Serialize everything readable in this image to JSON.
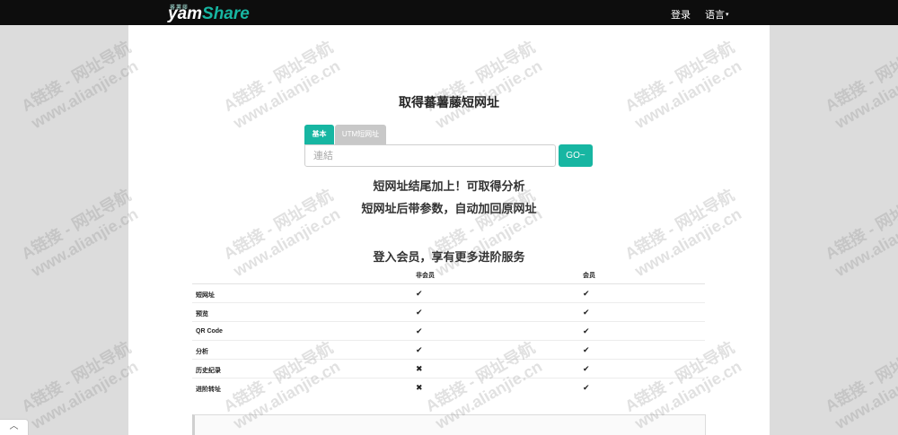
{
  "navbar": {
    "logo_small": "蕃薯藤",
    "logo_yam": "yam",
    "logo_share": "Share",
    "login_label": "登录",
    "language_label": "语言"
  },
  "main": {
    "title": "取得蕃薯藤短网址",
    "tabs": [
      {
        "label": "基本",
        "active": true
      },
      {
        "label": "UTM短网址",
        "active": false
      }
    ],
    "url_placeholder": "連結",
    "go_label": "GO~",
    "tip_1": "短网址结尾加上！可取得分析",
    "tip_2": "短网址后带参数，自动加回原网址",
    "members_title": "登入会员，享有更多进阶服务"
  },
  "comparison": {
    "headers": [
      "",
      "非会员",
      "会员"
    ],
    "rows": [
      {
        "feature": "短网址",
        "non_member": "✔",
        "member": "✔"
      },
      {
        "feature": "预览",
        "non_member": "✔",
        "member": "✔"
      },
      {
        "feature": "QR Code",
        "non_member": "✔",
        "member": "✔"
      },
      {
        "feature": "分析",
        "non_member": "✔",
        "member": "✔"
      },
      {
        "feature": "历史纪录",
        "non_member": "✖",
        "member": "✔"
      },
      {
        "feature": "进阶转址",
        "non_member": "✖",
        "member": "✔"
      }
    ]
  },
  "watermark": {
    "line_1": "A链接 - 网址导航",
    "line_2": "www.alianjie.cn"
  },
  "colors": {
    "accent": "#17b6a2",
    "navbar": "#0d0d0d",
    "tab_inactive": "#c8c8c8"
  },
  "icons": {
    "scroll_top": "chevron-up-icon",
    "language_caret": "caret-down-icon"
  }
}
